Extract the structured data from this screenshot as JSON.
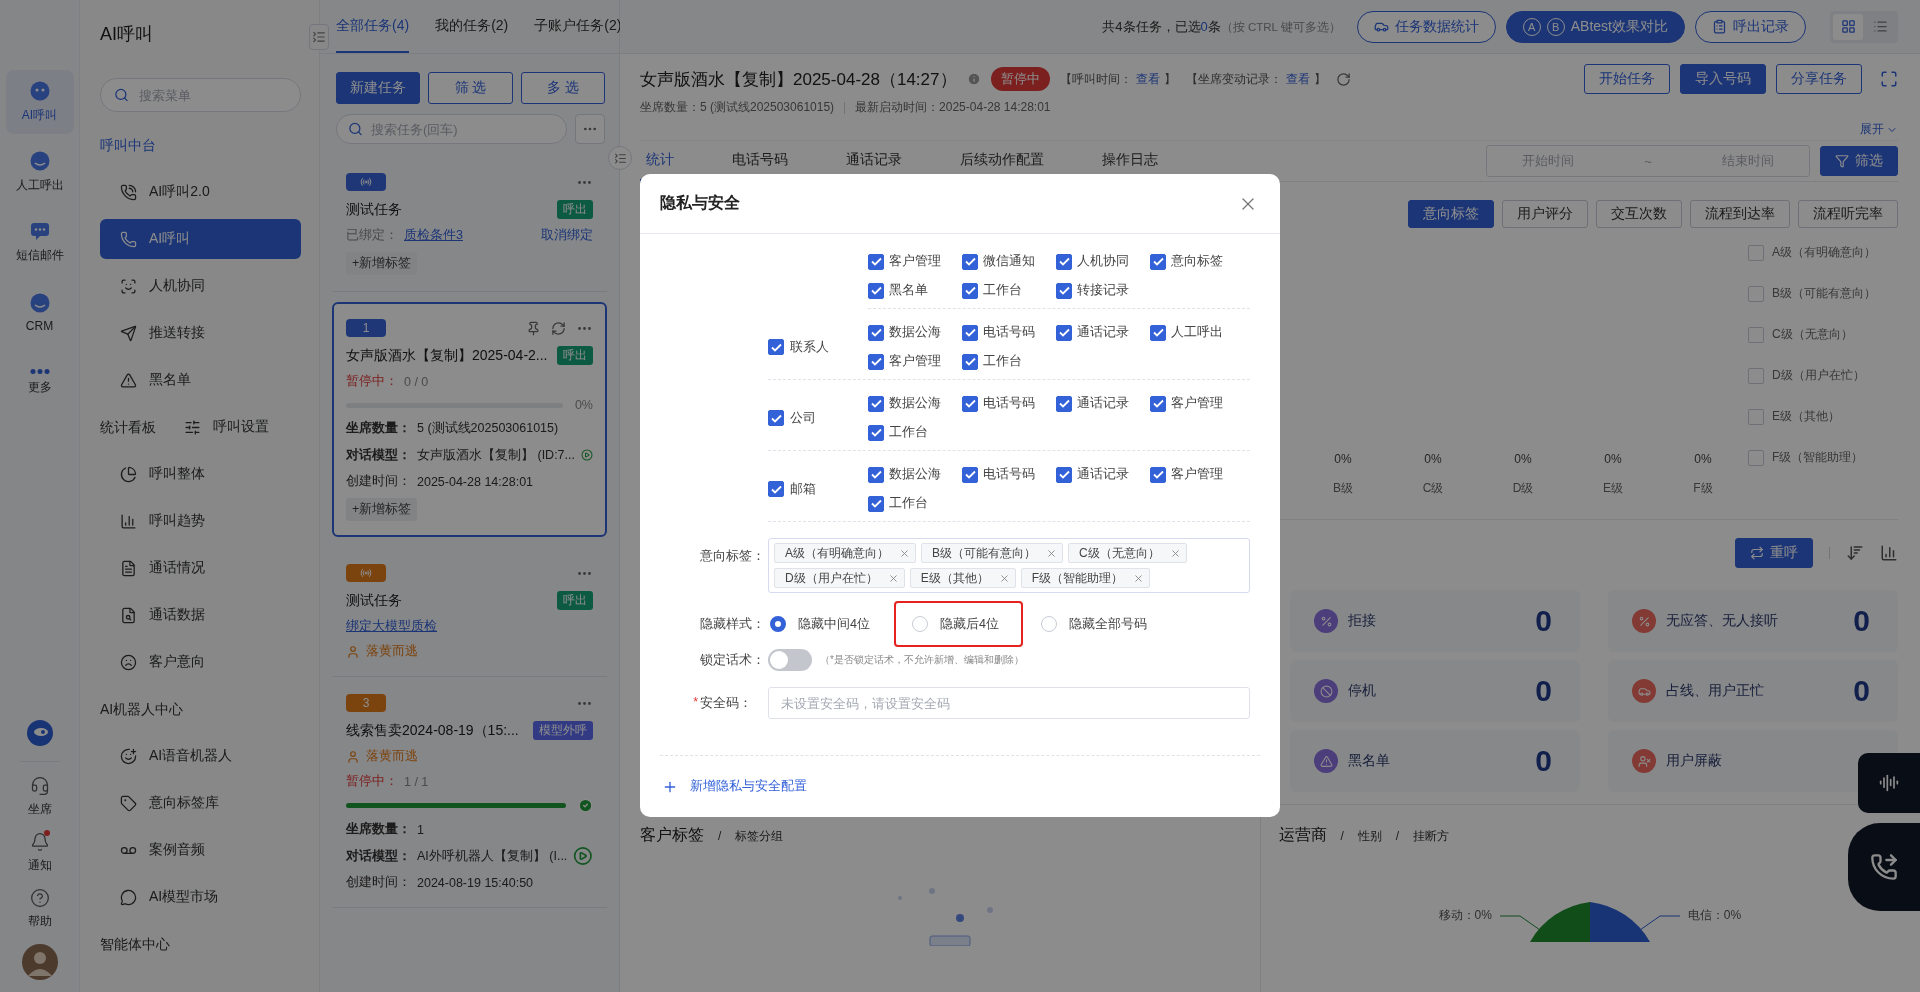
{
  "rail": {
    "items": [
      {
        "label": "AI呼叫",
        "selected": true
      },
      {
        "label": "人工呼出",
        "selected": false
      },
      {
        "label": "短信邮件",
        "selected": false
      },
      {
        "label": "CRM",
        "selected": false
      },
      {
        "label": "更多",
        "selected": false
      }
    ],
    "bottom": [
      {
        "label": "坐席",
        "badge": false
      },
      {
        "label": "通知",
        "badge": true
      },
      {
        "label": "帮助",
        "badge": false
      }
    ]
  },
  "sidebar": {
    "title": "AI呼叫",
    "search": {
      "placeholder": "搜索菜单"
    },
    "entries": [
      {
        "kind": "heading",
        "heading": "呼叫中台",
        "active": true
      },
      {
        "kind": "item",
        "label": "AI呼叫2.0",
        "selected": false
      },
      {
        "kind": "item",
        "label": "AI呼叫",
        "selected": true
      },
      {
        "kind": "item",
        "label": "人机协同",
        "selected": false
      },
      {
        "kind": "item",
        "label": "推送转接",
        "selected": false
      },
      {
        "kind": "item",
        "label": "黑名单",
        "selected": false
      },
      {
        "kind": "heading-over-item",
        "heading": "统计看板",
        "active": false,
        "label": "呼叫设置",
        "selected": false
      },
      {
        "kind": "item",
        "label": "呼叫整体",
        "selected": false
      },
      {
        "kind": "item",
        "label": "呼叫趋势",
        "selected": false
      },
      {
        "kind": "item",
        "label": "通话情况",
        "selected": false
      },
      {
        "kind": "item",
        "label": "通话数据",
        "selected": false
      },
      {
        "kind": "item",
        "label": "客户意向",
        "selected": false
      },
      {
        "kind": "heading",
        "heading": "AI机器人中心",
        "active": false
      },
      {
        "kind": "item",
        "label": "AI语音机器人",
        "selected": false
      },
      {
        "kind": "item",
        "label": "意向标签库",
        "selected": false
      },
      {
        "kind": "item",
        "label": "案例音频",
        "selected": false
      },
      {
        "kind": "item",
        "label": "AI模型市场",
        "selected": false
      },
      {
        "kind": "heading",
        "heading": "智能体中心",
        "active": false
      }
    ]
  },
  "task_list": {
    "tabs": [
      {
        "label": "全部任务(4)",
        "selected": true
      },
      {
        "label": "我的任务(2)",
        "selected": false
      },
      {
        "label": "子账户任务(2)",
        "selected": false
      }
    ],
    "buttons": [
      {
        "label": "新建任务",
        "primary": true
      },
      {
        "label": "筛 选",
        "primary": false
      },
      {
        "label": "多 选",
        "primary": false
      }
    ],
    "search": {
      "placeholder": "搜索任务(回车)"
    },
    "tasks": [
      {
        "badge": {
          "kind": "icon"
        },
        "color": "#203777",
        "selected": false,
        "extra_actions": false,
        "title": "测试任务",
        "tag": {
          "label": "呼出",
          "color": "#0e5a43"
        },
        "lines": [
          {
            "kind": "binding",
            "label": "已绑定：",
            "link": "质检条件3",
            "action": "取消绑定"
          },
          {
            "kind": "add_tag",
            "text": "+新增标签"
          }
        ]
      },
      {
        "badge": {
          "kind": "number",
          "text": "1"
        },
        "color": "#203777",
        "selected": true,
        "extra_actions": true,
        "title": "女声版酒水【复制】2025-04-2...",
        "tag": {
          "label": "呼出",
          "color": "#0e5a43"
        },
        "lines": [
          {
            "kind": "status",
            "label": "暂停中：",
            "value": "0 / 0"
          },
          {
            "kind": "progress",
            "reading": "0%",
            "done": false
          },
          {
            "kind": "field",
            "label": "坐席数量：",
            "value": "5 (测试线202503061015)",
            "strong": true,
            "play": false
          },
          {
            "kind": "field",
            "label": "对话模型：",
            "value": "女声版酒水【复制】 (ID:7...",
            "strong": true,
            "play": true
          },
          {
            "kind": "field",
            "label": "创建时间：",
            "value": "2025-04-28 14:28:01",
            "strong": false,
            "play": false
          },
          {
            "kind": "add_tag",
            "text": "+新增标签"
          }
        ]
      },
      {
        "badge": {
          "kind": "icon"
        },
        "color": "#7b440f",
        "selected": false,
        "extra_actions": false,
        "title": "测试任务",
        "tag": {
          "label": "呼出",
          "color": "#0e5a43"
        },
        "lines": [
          {
            "kind": "link",
            "text": "绑定大模型质检"
          },
          {
            "kind": "owner",
            "text": "落黄而逃"
          }
        ]
      },
      {
        "badge": {
          "kind": "number",
          "text": "3"
        },
        "color": "#7b440f",
        "selected": false,
        "extra_actions": false,
        "title": "线索售卖2024-08-19（15:...",
        "tag": {
          "label": "模型外呼",
          "color": "#323b84"
        },
        "lines": [
          {
            "kind": "owner",
            "text": "落黄而逃"
          },
          {
            "kind": "status",
            "label": "暂停中：",
            "value": "1 / 1"
          },
          {
            "kind": "progress",
            "level": 1,
            "done": true
          },
          {
            "kind": "field",
            "label": "坐席数量：",
            "value": "1",
            "strong": true,
            "play": false
          },
          {
            "kind": "field",
            "label": "对话模型：",
            "value": "AI外呼机器人【复制】 (I...",
            "strong": true,
            "play": true
          },
          {
            "kind": "field",
            "label": "创建时间：",
            "value": "2024-08-19 15:40:50",
            "strong": false,
            "play": false
          }
        ]
      }
    ]
  },
  "top_bar": {
    "summary": {
      "prefix": "共4条任务，已选",
      "count": "0",
      "suffix": "条",
      "hint": "（按 CTRL 键可多选）"
    },
    "buttons": [
      {
        "kind": "stats",
        "label": "任务数据统计",
        "primary": false
      },
      {
        "kind": "ab",
        "label": "ABtest效果对比",
        "primary": true,
        "marks": [
          "A",
          "B"
        ]
      },
      {
        "kind": "record",
        "label": "呼出记录",
        "primary": false
      }
    ],
    "views": [
      {
        "selected": true
      },
      {
        "selected": false
      }
    ]
  },
  "task_header": {
    "title": "女声版酒水【复制】2025-04-28（14:27）",
    "status": "暂停中",
    "meta_links": [
      {
        "prefix": "【呼叫时间：",
        "link": "查看",
        "suffix": "】"
      },
      {
        "prefix": "【坐席变动记录：",
        "link": "查看",
        "suffix": "】"
      }
    ],
    "buttons": [
      {
        "label": "开始任务",
        "primary": false
      },
      {
        "label": "导入号码",
        "primary": true
      },
      {
        "label": "分享任务",
        "primary": false
      }
    ],
    "info": [
      {
        "label": "坐席数量：",
        "value": "5 (测试线202503061015)"
      },
      {
        "label": "最新启动时间：",
        "value": "2025-04-28 14:28:01"
      }
    ],
    "expand": "展开"
  },
  "tabs": [
    {
      "label": "统计",
      "selected": true
    },
    {
      "label": "电话号码",
      "selected": false
    },
    {
      "label": "通话记录",
      "selected": false
    },
    {
      "label": "后续动作配置",
      "selected": false
    },
    {
      "label": "操作日志",
      "selected": false
    }
  ],
  "date_range": {
    "start_placeholder": "开始时间",
    "separator": "~",
    "end_placeholder": "结束时间",
    "button": "筛选"
  },
  "chart_panel": {
    "metrics": [
      {
        "label": "意向标签",
        "selected": true
      },
      {
        "label": "用户评分",
        "selected": false
      },
      {
        "label": "交互次数",
        "selected": false
      },
      {
        "label": "流程到达率",
        "selected": false
      },
      {
        "label": "流程听完率",
        "selected": false
      }
    ],
    "bar_labels": [
      {
        "value": "0%",
        "category": "B级"
      },
      {
        "value": "0%",
        "category": "C级"
      },
      {
        "value": "0%",
        "category": "D级"
      },
      {
        "value": "0%",
        "category": "E级"
      },
      {
        "value": "0%",
        "category": "F级"
      }
    ],
    "legend": [
      {
        "label": "A级（有明确意向）",
        "checked": false
      },
      {
        "label": "B级（可能有意向）",
        "checked": false
      },
      {
        "label": "C级（无意向）",
        "checked": false
      },
      {
        "label": "D级（用户在忙）",
        "checked": false
      },
      {
        "label": "E级（其他）",
        "checked": false
      },
      {
        "label": "F级（智能助理）",
        "checked": false
      }
    ]
  },
  "stats": {
    "recall_button": "重呼",
    "cards": [
      {
        "label": "拒接",
        "value": "0",
        "color": "#4c3d7b"
      },
      {
        "label": "无应答、无人接听",
        "value": "0",
        "color": "#833a34"
      },
      {
        "label": "停机",
        "value": "0",
        "color": "#4c3d7b"
      },
      {
        "label": "占线、用户正忙",
        "value": "0",
        "color": "#833a34"
      },
      {
        "label": "黑名单",
        "value": "0",
        "color": "#4c3d7b"
      },
      {
        "label": "用户屏蔽",
        "color": "#833a34"
      }
    ]
  },
  "customer_tags": {
    "title": "客户标签",
    "separator": "/",
    "sub": "标签分组"
  },
  "carrier": {
    "title": "运营商",
    "tabs": [
      {
        "separator": "/",
        "label": "性别"
      },
      {
        "separator": "/",
        "label": "挂断方"
      }
    ],
    "pie_labels": [
      "移动：0%",
      "电信：0%"
    ]
  },
  "dialog": {
    "title": "隐私与安全",
    "groups": [
      {
        "items": [
          {
            "label": "客户管理",
            "checked": true
          },
          {
            "label": "微信通知",
            "checked": true
          },
          {
            "label": "人机协同",
            "checked": true
          },
          {
            "label": "意向标签",
            "checked": true
          },
          {
            "label": "黑名单",
            "checked": true
          },
          {
            "label": "工作台",
            "checked": true
          },
          {
            "label": "转接记录",
            "checked": true
          }
        ]
      },
      {
        "label": "联系人",
        "checked": true,
        "items": [
          {
            "label": "数据公海",
            "checked": true
          },
          {
            "label": "电话号码",
            "checked": true
          },
          {
            "label": "通话记录",
            "checked": true
          },
          {
            "label": "人工呼出",
            "checked": true
          },
          {
            "label": "客户管理",
            "checked": true
          },
          {
            "label": "工作台",
            "checked": true
          }
        ]
      },
      {
        "label": "公司",
        "checked": true,
        "items": [
          {
            "label": "数据公海",
            "checked": true
          },
          {
            "label": "电话号码",
            "checked": true
          },
          {
            "label": "通话记录",
            "checked": true
          },
          {
            "label": "客户管理",
            "checked": true
          },
          {
            "label": "工作台",
            "checked": true
          }
        ]
      },
      {
        "label": "邮箱",
        "checked": true,
        "items": [
          {
            "label": "数据公海",
            "checked": true
          },
          {
            "label": "电话号码",
            "checked": true
          },
          {
            "label": "通话记录",
            "checked": true
          },
          {
            "label": "客户管理",
            "checked": true
          },
          {
            "label": "工作台",
            "checked": true
          }
        ]
      }
    ],
    "intent_tags": {
      "label": "意向标签：",
      "tags": [
        "A级（有明确意向）",
        "B级（可能有意向）",
        "C级（无意向）",
        "D级（用户在忙）",
        "E级（其他）",
        "F级（智能助理）"
      ]
    },
    "hide_style": {
      "label": "隐藏样式：",
      "options": [
        {
          "label": "隐藏中间4位",
          "selected": true,
          "highlighted": false
        },
        {
          "label": "隐藏后4位",
          "selected": false,
          "highlighted": true
        },
        {
          "label": "隐藏全部号码",
          "selected": false,
          "highlighted": false
        }
      ]
    },
    "lock_script": {
      "label": "锁定话术：",
      "on": false,
      "hint": "（*是否锁定话术，不允许新增、编辑和删除）"
    },
    "security_code": {
      "required_mark": "*",
      "label": "安全码：",
      "placeholder": "未设置安全码，请设置安全码"
    },
    "add_config": "新增隐私与安全配置"
  }
}
